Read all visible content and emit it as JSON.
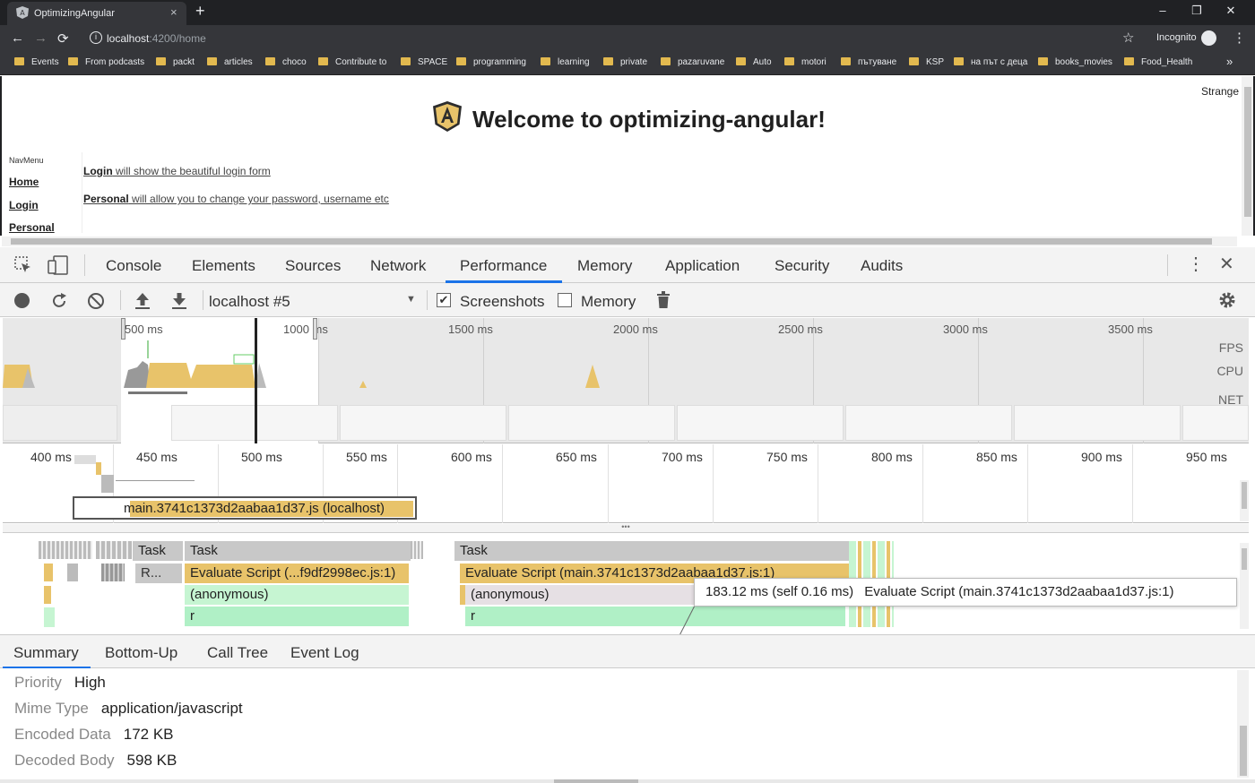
{
  "browser": {
    "tab_title": "OptimizingAngular",
    "tab_close": "×",
    "new_tab": "+",
    "window_controls": [
      "–",
      "❐",
      "✕"
    ],
    "nav": {
      "back": "←",
      "forward": "→",
      "reload": "⟳"
    },
    "url_host": "localhost",
    "url_path": ":4200/home",
    "incognito_label": "Incognito",
    "bookmarks": [
      "Events",
      "From podcasts",
      "packt",
      "articles",
      "choco",
      "Contribute to",
      "SPACE",
      "programming",
      "learning",
      "private",
      "pazaruvane",
      "Auto",
      "motori",
      "пътуване",
      "KSP",
      "на път с деца",
      "books_movies",
      "Food_Health"
    ],
    "bookmarks_overflow": "»"
  },
  "page": {
    "corner_text": "Strange",
    "heading": "Welcome to optimizing-angular!",
    "navmenu_label": "NavMenu",
    "nav_links": [
      "Home",
      "Login",
      "Personal"
    ],
    "login_desc_link": "Login",
    "login_desc_text": " will show the beautiful login form",
    "personal_desc_link": "Personal",
    "personal_desc_text": " will allow you to change your password, username etc"
  },
  "devtools": {
    "tabs": [
      "Console",
      "Elements",
      "Sources",
      "Network",
      "Performance",
      "Memory",
      "Application",
      "Security",
      "Audits"
    ],
    "active_tab": "Performance",
    "profile_select": "localhost #5",
    "screenshots_label": "Screenshots",
    "screenshots_checked": true,
    "memory_label": "Memory",
    "memory_checked": false,
    "overview_ticks": [
      "500 ms",
      "1000 ms",
      "1500 ms",
      "2000 ms",
      "2500 ms",
      "3000 ms",
      "3500 ms"
    ],
    "overview_labels": [
      "FPS",
      "CPU",
      "NET"
    ],
    "ruler_ticks": [
      "400 ms",
      "450 ms",
      "500 ms",
      "550 ms",
      "600 ms",
      "650 ms",
      "700 ms",
      "750 ms",
      "800 ms",
      "850 ms",
      "900 ms",
      "950 ms"
    ],
    "network_request": "main.3741c1373d2aabaa1d37.js (localhost)",
    "flame": {
      "task_label": "Task",
      "r_label": "R...",
      "eval1": "Evaluate Script (...f9df2998ec.js:1)",
      "eval2": "Evaluate Script (main.3741c1373d2aabaa1d37.js:1)",
      "anon": "(anonymous)",
      "r": "r"
    },
    "tooltip": {
      "time": "183.12 ms (self 0.16 ms)",
      "label": "Evaluate Script (main.3741c1373d2aabaa1d37.js:1)"
    },
    "bottom_tabs": [
      "Summary",
      "Bottom-Up",
      "Call Tree",
      "Event Log"
    ],
    "summary": [
      {
        "key": "Priority",
        "value": "High"
      },
      {
        "key": "Mime Type",
        "value": "application/javascript"
      },
      {
        "key": "Encoded Data",
        "value": "172 KB"
      },
      {
        "key": "Decoded Body",
        "value": "598 KB"
      }
    ]
  },
  "colors": {
    "scripting": "#e8c36a",
    "task": "#c8c8c8",
    "anonymous": "#c6f5d2",
    "accent": "#1a73e8",
    "chrome_dark": "#35363a"
  }
}
